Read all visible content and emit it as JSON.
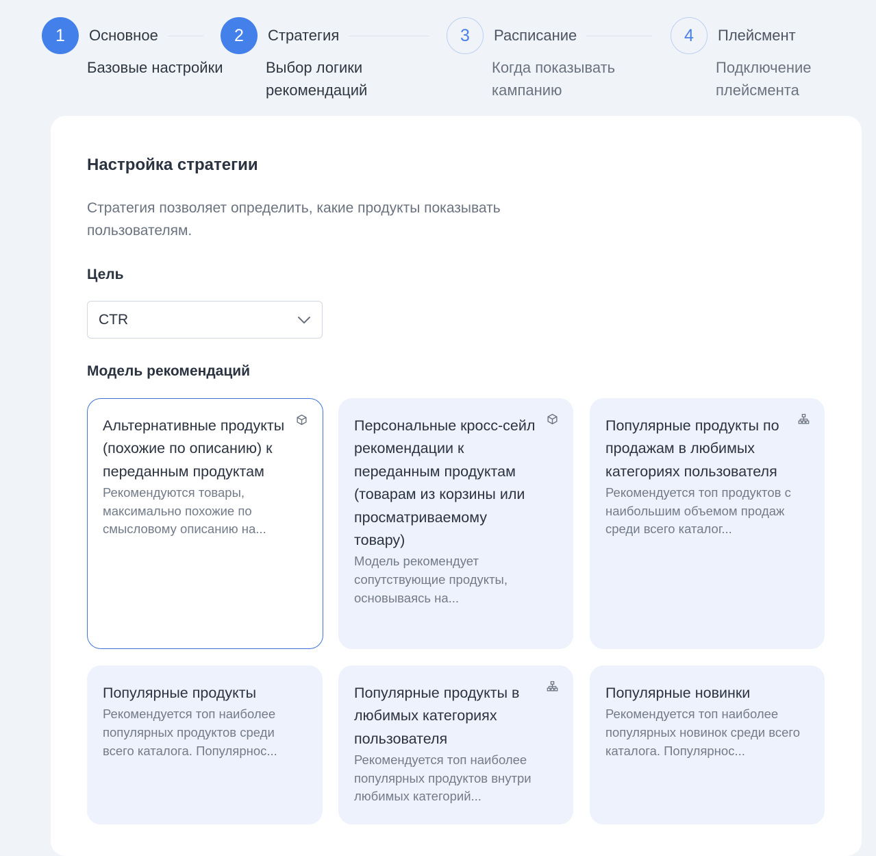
{
  "stepper": {
    "steps": [
      {
        "number": "1",
        "title": "Основное",
        "description": "Базовые настройки",
        "state": "done"
      },
      {
        "number": "2",
        "title": "Стратегия",
        "description": "Выбор логики рекомендаций",
        "state": "current"
      },
      {
        "number": "3",
        "title": "Расписание",
        "description": "Когда показывать кампанию",
        "state": "upcoming"
      },
      {
        "number": "4",
        "title": "Плейсмент",
        "description": "Подключение плейсмента",
        "state": "upcoming"
      }
    ]
  },
  "strategy": {
    "title": "Настройка стратегии",
    "description": "Стратегия позволяет определить, какие продукты показывать пользователям.",
    "goal_label": "Цель",
    "goal_value": "CTR",
    "model_label": "Модель рекомендаций"
  },
  "models": [
    {
      "title": "Альтернативные продукты (похожие по описанию) к переданным продуктам",
      "description": "Рекомендуются товары, максимально похожие по смысловому описанию на...",
      "icon": "cube-icon",
      "selected": true
    },
    {
      "title": "Персональные кросс-сейл рекомендации к переданным продуктам (товарам из корзины или просматриваемому товару)",
      "description": "Модель рекомендует сопутствующие продукты, основываясь на...",
      "icon": "cube-icon",
      "selected": false
    },
    {
      "title": "Популярные продукты по продажам в любимых категориях пользователя",
      "description": "Рекомендуется топ продуктов с наибольшим объемом продаж среди всего каталог...",
      "icon": "hierarchy-icon",
      "selected": false
    },
    {
      "title": "Популярные продукты",
      "description": "Рекомендуется топ наиболее популярных продуктов среди всего каталога. Популярнос...",
      "icon": "",
      "selected": false
    },
    {
      "title": "Популярные продукты в любимых категориях пользователя",
      "description": "Рекомендуется топ наиболее популярных продуктов внутри любимых категорий...",
      "icon": "hierarchy-icon",
      "selected": false
    },
    {
      "title": "Популярные новинки",
      "description": "Рекомендуется топ наиболее популярных новинок среди всего каталога. Популярнос...",
      "icon": "",
      "selected": false
    }
  ],
  "colors": {
    "accent": "#4480ea",
    "selected_border": "#3f72d8",
    "card_bg": "#edf2fd",
    "page_bg": "#f0f3f8"
  }
}
